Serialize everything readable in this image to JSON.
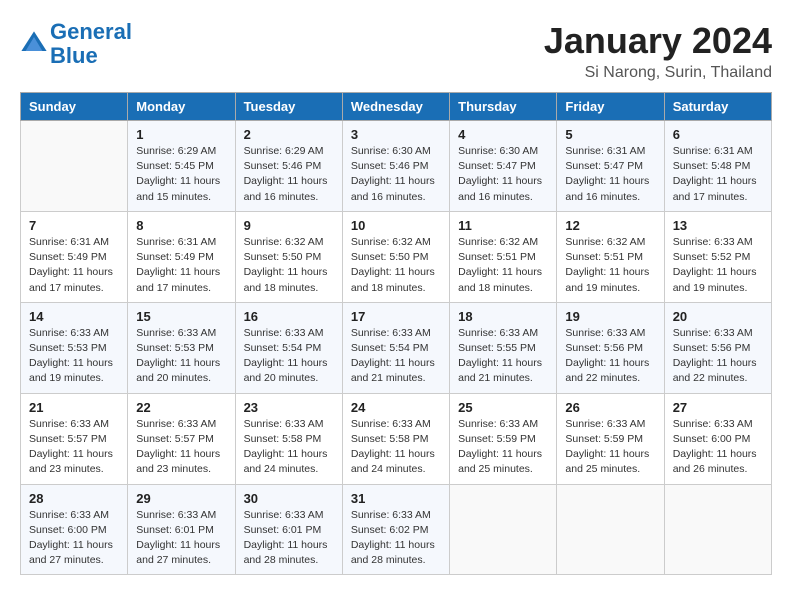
{
  "logo": {
    "line1": "General",
    "line2": "Blue"
  },
  "title": "January 2024",
  "location": "Si Narong, Surin, Thailand",
  "days_of_week": [
    "Sunday",
    "Monday",
    "Tuesday",
    "Wednesday",
    "Thursday",
    "Friday",
    "Saturday"
  ],
  "weeks": [
    [
      {
        "day": "",
        "sunrise": "",
        "sunset": "",
        "daylight": ""
      },
      {
        "day": "1",
        "sunrise": "Sunrise: 6:29 AM",
        "sunset": "Sunset: 5:45 PM",
        "daylight": "Daylight: 11 hours and 15 minutes."
      },
      {
        "day": "2",
        "sunrise": "Sunrise: 6:29 AM",
        "sunset": "Sunset: 5:46 PM",
        "daylight": "Daylight: 11 hours and 16 minutes."
      },
      {
        "day": "3",
        "sunrise": "Sunrise: 6:30 AM",
        "sunset": "Sunset: 5:46 PM",
        "daylight": "Daylight: 11 hours and 16 minutes."
      },
      {
        "day": "4",
        "sunrise": "Sunrise: 6:30 AM",
        "sunset": "Sunset: 5:47 PM",
        "daylight": "Daylight: 11 hours and 16 minutes."
      },
      {
        "day": "5",
        "sunrise": "Sunrise: 6:31 AM",
        "sunset": "Sunset: 5:47 PM",
        "daylight": "Daylight: 11 hours and 16 minutes."
      },
      {
        "day": "6",
        "sunrise": "Sunrise: 6:31 AM",
        "sunset": "Sunset: 5:48 PM",
        "daylight": "Daylight: 11 hours and 17 minutes."
      }
    ],
    [
      {
        "day": "7",
        "sunrise": "Sunrise: 6:31 AM",
        "sunset": "Sunset: 5:49 PM",
        "daylight": "Daylight: 11 hours and 17 minutes."
      },
      {
        "day": "8",
        "sunrise": "Sunrise: 6:31 AM",
        "sunset": "Sunset: 5:49 PM",
        "daylight": "Daylight: 11 hours and 17 minutes."
      },
      {
        "day": "9",
        "sunrise": "Sunrise: 6:32 AM",
        "sunset": "Sunset: 5:50 PM",
        "daylight": "Daylight: 11 hours and 18 minutes."
      },
      {
        "day": "10",
        "sunrise": "Sunrise: 6:32 AM",
        "sunset": "Sunset: 5:50 PM",
        "daylight": "Daylight: 11 hours and 18 minutes."
      },
      {
        "day": "11",
        "sunrise": "Sunrise: 6:32 AM",
        "sunset": "Sunset: 5:51 PM",
        "daylight": "Daylight: 11 hours and 18 minutes."
      },
      {
        "day": "12",
        "sunrise": "Sunrise: 6:32 AM",
        "sunset": "Sunset: 5:51 PM",
        "daylight": "Daylight: 11 hours and 19 minutes."
      },
      {
        "day": "13",
        "sunrise": "Sunrise: 6:33 AM",
        "sunset": "Sunset: 5:52 PM",
        "daylight": "Daylight: 11 hours and 19 minutes."
      }
    ],
    [
      {
        "day": "14",
        "sunrise": "Sunrise: 6:33 AM",
        "sunset": "Sunset: 5:53 PM",
        "daylight": "Daylight: 11 hours and 19 minutes."
      },
      {
        "day": "15",
        "sunrise": "Sunrise: 6:33 AM",
        "sunset": "Sunset: 5:53 PM",
        "daylight": "Daylight: 11 hours and 20 minutes."
      },
      {
        "day": "16",
        "sunrise": "Sunrise: 6:33 AM",
        "sunset": "Sunset: 5:54 PM",
        "daylight": "Daylight: 11 hours and 20 minutes."
      },
      {
        "day": "17",
        "sunrise": "Sunrise: 6:33 AM",
        "sunset": "Sunset: 5:54 PM",
        "daylight": "Daylight: 11 hours and 21 minutes."
      },
      {
        "day": "18",
        "sunrise": "Sunrise: 6:33 AM",
        "sunset": "Sunset: 5:55 PM",
        "daylight": "Daylight: 11 hours and 21 minutes."
      },
      {
        "day": "19",
        "sunrise": "Sunrise: 6:33 AM",
        "sunset": "Sunset: 5:56 PM",
        "daylight": "Daylight: 11 hours and 22 minutes."
      },
      {
        "day": "20",
        "sunrise": "Sunrise: 6:33 AM",
        "sunset": "Sunset: 5:56 PM",
        "daylight": "Daylight: 11 hours and 22 minutes."
      }
    ],
    [
      {
        "day": "21",
        "sunrise": "Sunrise: 6:33 AM",
        "sunset": "Sunset: 5:57 PM",
        "daylight": "Daylight: 11 hours and 23 minutes."
      },
      {
        "day": "22",
        "sunrise": "Sunrise: 6:33 AM",
        "sunset": "Sunset: 5:57 PM",
        "daylight": "Daylight: 11 hours and 23 minutes."
      },
      {
        "day": "23",
        "sunrise": "Sunrise: 6:33 AM",
        "sunset": "Sunset: 5:58 PM",
        "daylight": "Daylight: 11 hours and 24 minutes."
      },
      {
        "day": "24",
        "sunrise": "Sunrise: 6:33 AM",
        "sunset": "Sunset: 5:58 PM",
        "daylight": "Daylight: 11 hours and 24 minutes."
      },
      {
        "day": "25",
        "sunrise": "Sunrise: 6:33 AM",
        "sunset": "Sunset: 5:59 PM",
        "daylight": "Daylight: 11 hours and 25 minutes."
      },
      {
        "day": "26",
        "sunrise": "Sunrise: 6:33 AM",
        "sunset": "Sunset: 5:59 PM",
        "daylight": "Daylight: 11 hours and 25 minutes."
      },
      {
        "day": "27",
        "sunrise": "Sunrise: 6:33 AM",
        "sunset": "Sunset: 6:00 PM",
        "daylight": "Daylight: 11 hours and 26 minutes."
      }
    ],
    [
      {
        "day": "28",
        "sunrise": "Sunrise: 6:33 AM",
        "sunset": "Sunset: 6:00 PM",
        "daylight": "Daylight: 11 hours and 27 minutes."
      },
      {
        "day": "29",
        "sunrise": "Sunrise: 6:33 AM",
        "sunset": "Sunset: 6:01 PM",
        "daylight": "Daylight: 11 hours and 27 minutes."
      },
      {
        "day": "30",
        "sunrise": "Sunrise: 6:33 AM",
        "sunset": "Sunset: 6:01 PM",
        "daylight": "Daylight: 11 hours and 28 minutes."
      },
      {
        "day": "31",
        "sunrise": "Sunrise: 6:33 AM",
        "sunset": "Sunset: 6:02 PM",
        "daylight": "Daylight: 11 hours and 28 minutes."
      },
      {
        "day": "",
        "sunrise": "",
        "sunset": "",
        "daylight": ""
      },
      {
        "day": "",
        "sunrise": "",
        "sunset": "",
        "daylight": ""
      },
      {
        "day": "",
        "sunrise": "",
        "sunset": "",
        "daylight": ""
      }
    ]
  ]
}
